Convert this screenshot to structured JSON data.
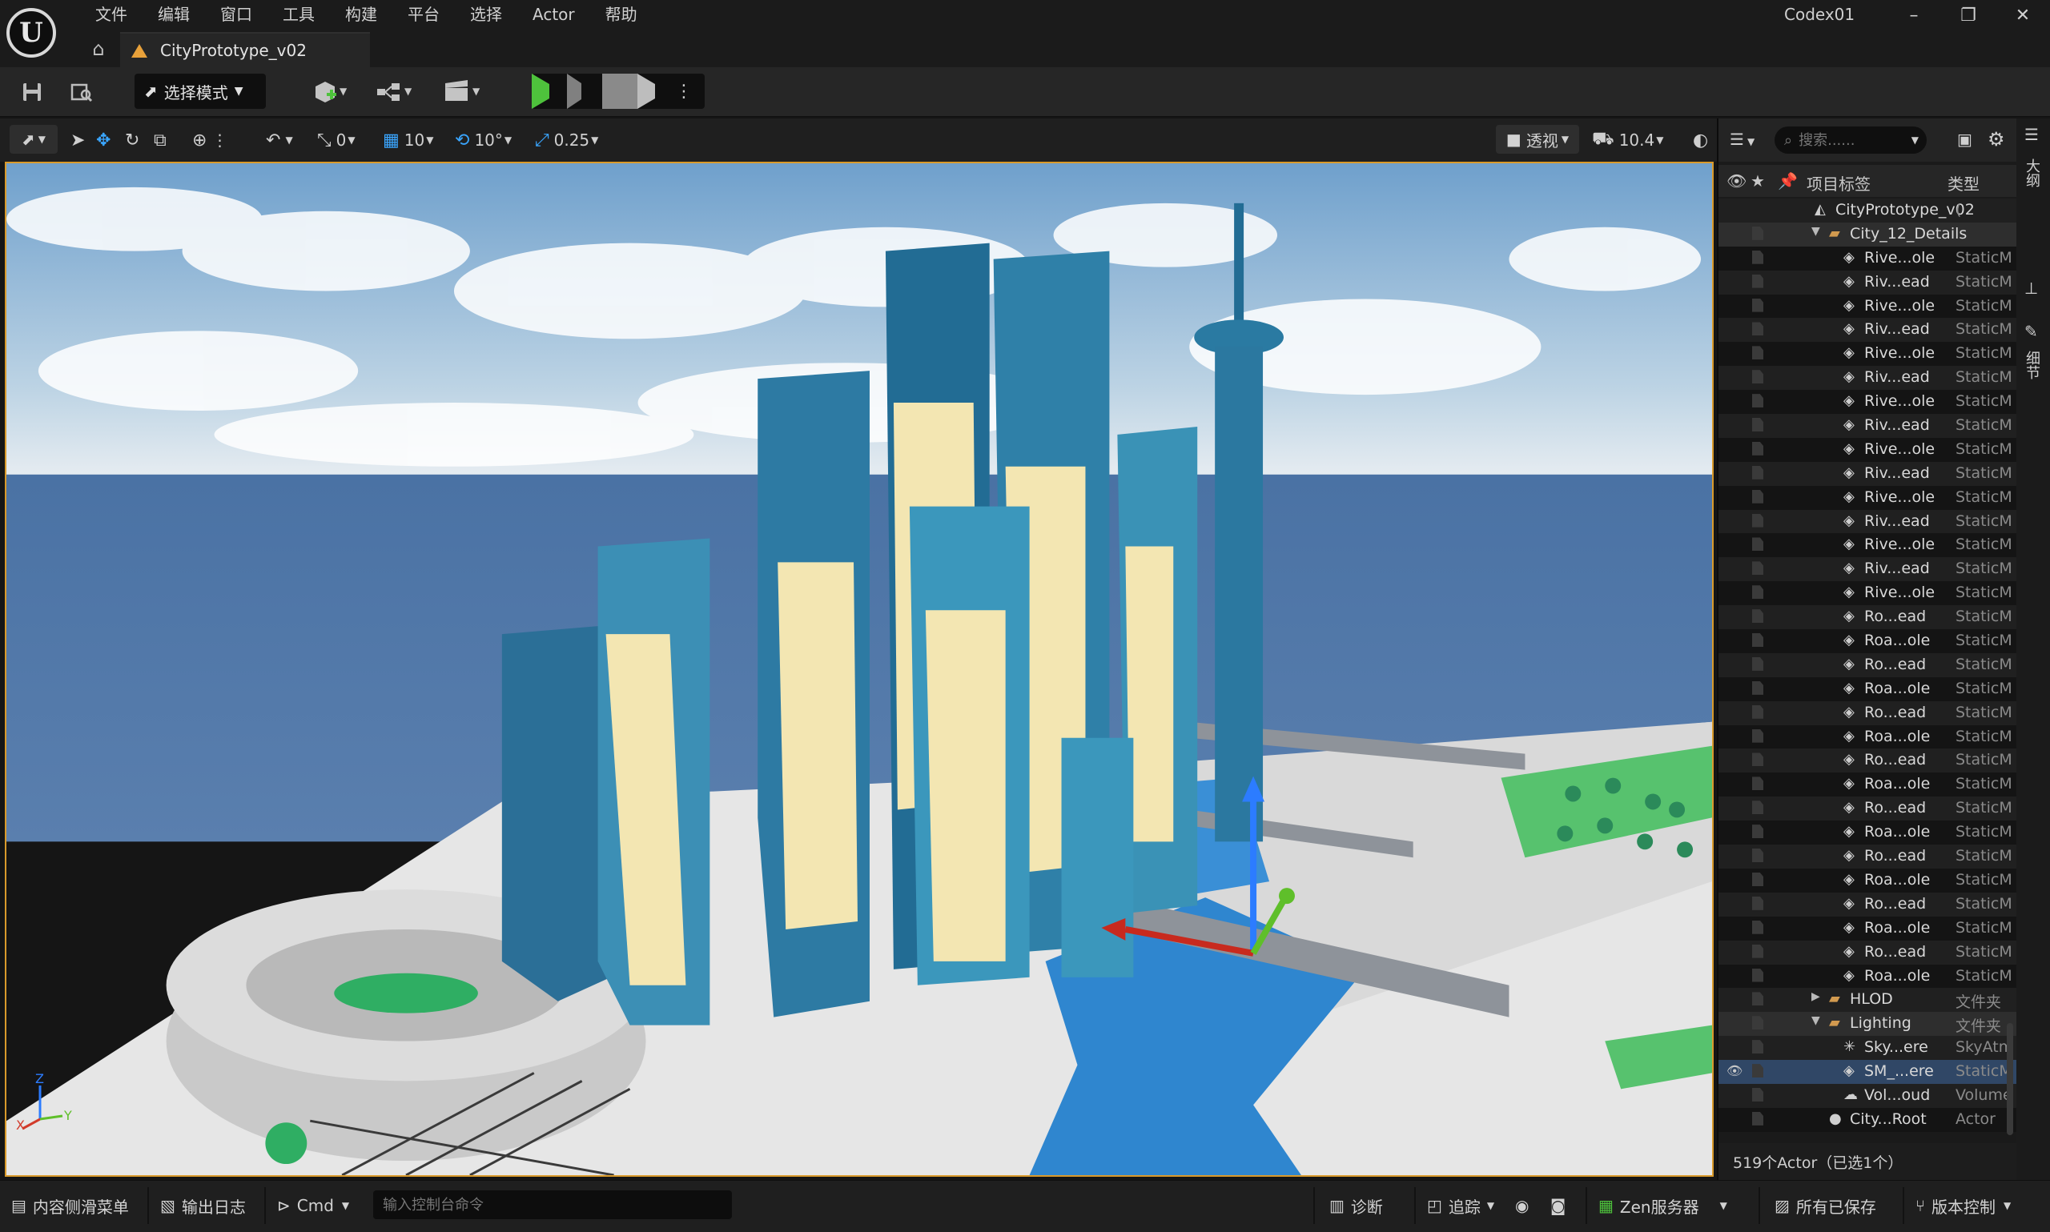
{
  "menu": [
    "文件",
    "编辑",
    "窗口",
    "工具",
    "构建",
    "平台",
    "选择",
    "Actor",
    "帮助"
  ],
  "window": {
    "project": "Codex01",
    "minimize": "–",
    "restore": "❐",
    "close": "✕"
  },
  "logo": "U",
  "doc_tab": {
    "label": "CityPrototype_v02"
  },
  "toolbar": {
    "mode_label": "选择模式"
  },
  "viewport_toolbar": {
    "rotate_snap": "0",
    "grid_snap": "10",
    "angle_snap": "10°",
    "scale_snap": "0.25",
    "perspective": "透视",
    "camera_speed": "10.4"
  },
  "viewport": {
    "axis_x": "X",
    "axis_y": "Y",
    "axis_z": "Z"
  },
  "outliner": {
    "search_placeholder": "搜索......",
    "col_label": "项目标签",
    "col_type": "类型",
    "footer": "519个Actor（已选1个）",
    "rows": [
      {
        "indent": 0,
        "kind": "level",
        "name": "CityPrototype_v02",
        "type": "(",
        "style": "light"
      },
      {
        "indent": 1,
        "kind": "folder",
        "name": "City_12_Details",
        "type": "",
        "style": "folderhl",
        "expanded": true
      },
      {
        "indent": 2,
        "kind": "mesh",
        "name": "Rive...ole",
        "type": "StaticM"
      },
      {
        "indent": 2,
        "kind": "mesh",
        "name": "Riv...ead",
        "type": "StaticM"
      },
      {
        "indent": 2,
        "kind": "mesh",
        "name": "Rive...ole",
        "type": "StaticM"
      },
      {
        "indent": 2,
        "kind": "mesh",
        "name": "Riv...ead",
        "type": "StaticM"
      },
      {
        "indent": 2,
        "kind": "mesh",
        "name": "Rive...ole",
        "type": "StaticM"
      },
      {
        "indent": 2,
        "kind": "mesh",
        "name": "Riv...ead",
        "type": "StaticM"
      },
      {
        "indent": 2,
        "kind": "mesh",
        "name": "Rive...ole",
        "type": "StaticM"
      },
      {
        "indent": 2,
        "kind": "mesh",
        "name": "Riv...ead",
        "type": "StaticM"
      },
      {
        "indent": 2,
        "kind": "mesh",
        "name": "Rive...ole",
        "type": "StaticM"
      },
      {
        "indent": 2,
        "kind": "mesh",
        "name": "Riv...ead",
        "type": "StaticM"
      },
      {
        "indent": 2,
        "kind": "mesh",
        "name": "Rive...ole",
        "type": "StaticM"
      },
      {
        "indent": 2,
        "kind": "mesh",
        "name": "Riv...ead",
        "type": "StaticM"
      },
      {
        "indent": 2,
        "kind": "mesh",
        "name": "Rive...ole",
        "type": "StaticM"
      },
      {
        "indent": 2,
        "kind": "mesh",
        "name": "Riv...ead",
        "type": "StaticM"
      },
      {
        "indent": 2,
        "kind": "mesh",
        "name": "Rive...ole",
        "type": "StaticM"
      },
      {
        "indent": 2,
        "kind": "mesh",
        "name": "Ro...ead",
        "type": "StaticM"
      },
      {
        "indent": 2,
        "kind": "mesh",
        "name": "Roa...ole",
        "type": "StaticM"
      },
      {
        "indent": 2,
        "kind": "mesh",
        "name": "Ro...ead",
        "type": "StaticM"
      },
      {
        "indent": 2,
        "kind": "mesh",
        "name": "Roa...ole",
        "type": "StaticM"
      },
      {
        "indent": 2,
        "kind": "mesh",
        "name": "Ro...ead",
        "type": "StaticM"
      },
      {
        "indent": 2,
        "kind": "mesh",
        "name": "Roa...ole",
        "type": "StaticM"
      },
      {
        "indent": 2,
        "kind": "mesh",
        "name": "Ro...ead",
        "type": "StaticM"
      },
      {
        "indent": 2,
        "kind": "mesh",
        "name": "Roa...ole",
        "type": "StaticM"
      },
      {
        "indent": 2,
        "kind": "mesh",
        "name": "Ro...ead",
        "type": "StaticM"
      },
      {
        "indent": 2,
        "kind": "mesh",
        "name": "Roa...ole",
        "type": "StaticM"
      },
      {
        "indent": 2,
        "kind": "mesh",
        "name": "Ro...ead",
        "type": "StaticM"
      },
      {
        "indent": 2,
        "kind": "mesh",
        "name": "Roa...ole",
        "type": "StaticM"
      },
      {
        "indent": 2,
        "kind": "mesh",
        "name": "Ro...ead",
        "type": "StaticM"
      },
      {
        "indent": 2,
        "kind": "mesh",
        "name": "Roa...ole",
        "type": "StaticM"
      },
      {
        "indent": 2,
        "kind": "mesh",
        "name": "Ro...ead",
        "type": "StaticM"
      },
      {
        "indent": 2,
        "kind": "mesh",
        "name": "Roa...ole",
        "type": "StaticM"
      },
      {
        "indent": 1,
        "kind": "folder",
        "name": "HLOD",
        "type": "文件夹",
        "expanded": false
      },
      {
        "indent": 1,
        "kind": "folder",
        "name": "Lighting",
        "type": "文件夹",
        "style": "folderhl",
        "expanded": true
      },
      {
        "indent": 2,
        "kind": "sky",
        "name": "Sky...ere",
        "type": "SkyAtm"
      },
      {
        "indent": 2,
        "kind": "mesh",
        "name": "SM_...ere",
        "type": "StaticM",
        "style": "sel",
        "visible": true
      },
      {
        "indent": 2,
        "kind": "cloud",
        "name": "Vol...oud",
        "type": "Volume"
      },
      {
        "indent": 1,
        "kind": "actor",
        "name": "City...Root",
        "type": "Actor"
      }
    ]
  },
  "side_tabs": {
    "outliner": "大纲",
    "details": "细节"
  },
  "statusbar": {
    "content_drawer": "内容侧滑菜单",
    "output_log": "输出日志",
    "cmd": "Cmd",
    "console_placeholder": "输入控制台命令",
    "diagnostics": "诊断",
    "trace": "追踪",
    "zen": "Zen服务器",
    "saved": "所有已保存",
    "source_control": "版本控制"
  },
  "colors": {
    "accent_orange": "#d99a2b",
    "play_green": "#4ec23c",
    "selection_blue": "#304766"
  }
}
